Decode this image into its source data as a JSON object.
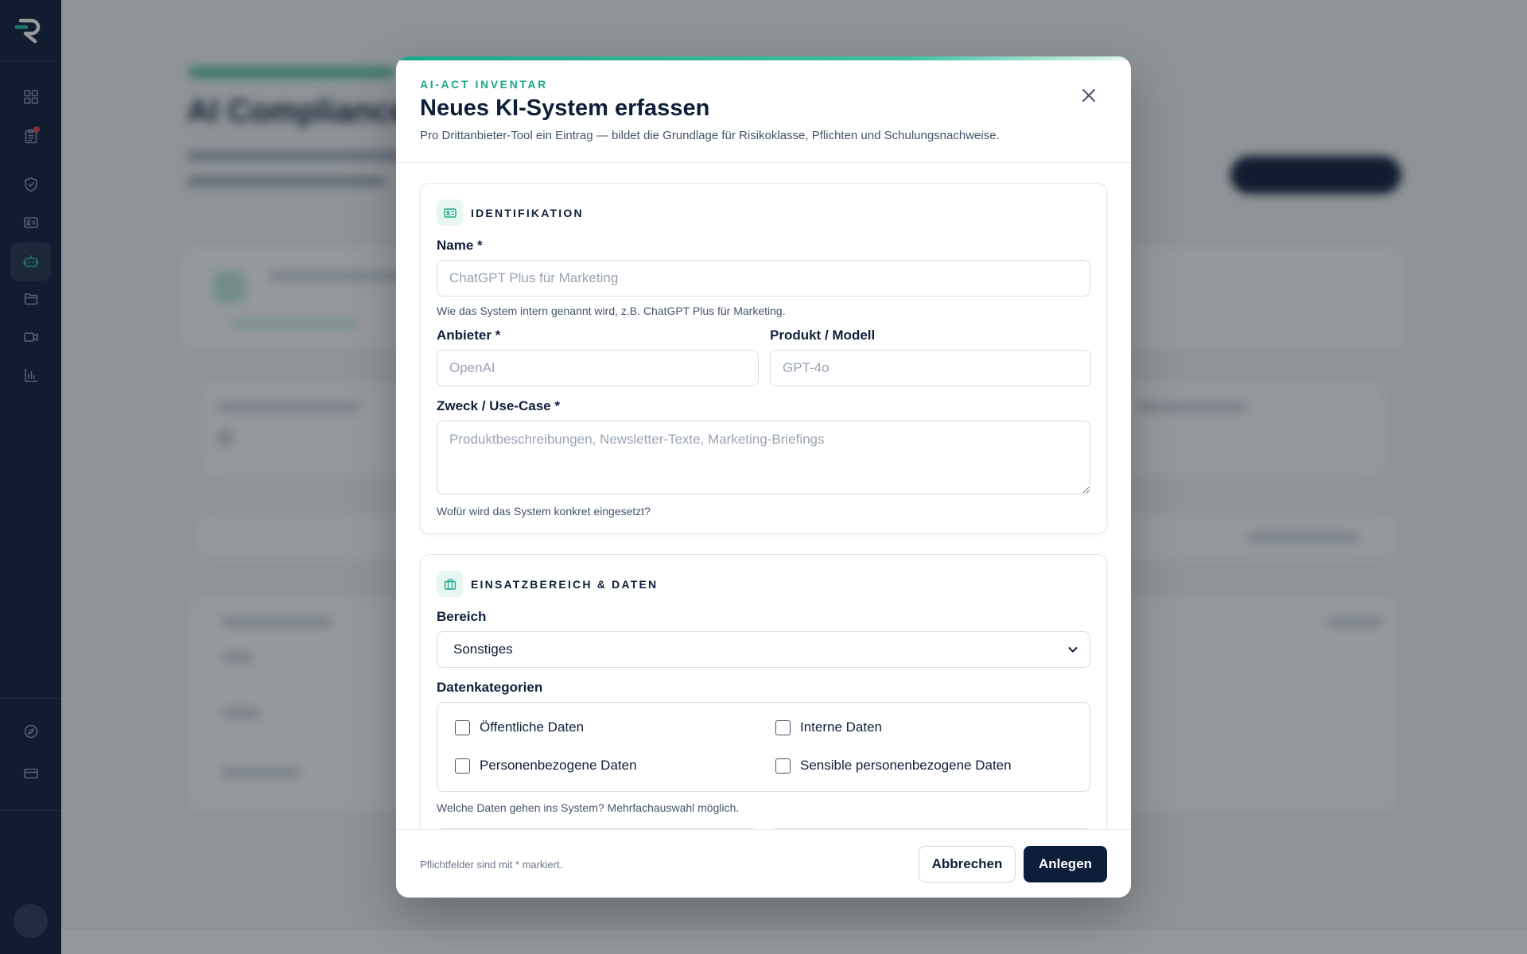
{
  "background": {
    "page_title": "AI Compliance"
  },
  "modal": {
    "eyebrow": "AI-ACT INVENTAR",
    "title": "Neues KI-System erfassen",
    "description": "Pro Drittanbieter-Tool ein Eintrag — bildet die Grundlage für Risikoklasse, Pflichten und Schulungsnachweise.",
    "close_icon": "close-icon",
    "sections": {
      "identifikation": {
        "title": "IDENTIFIKATION",
        "icon": "id-card-icon",
        "name": {
          "label": "Name *",
          "value": "",
          "placeholder": "ChatGPT Plus für Marketing",
          "hint": "Wie das System intern genannt wird, z.B. ChatGPT Plus für Marketing."
        },
        "anbieter": {
          "label": "Anbieter *",
          "value": "",
          "placeholder": "OpenAI"
        },
        "produkt": {
          "label": "Produkt / Modell",
          "value": "",
          "placeholder": "GPT-4o"
        },
        "zweck": {
          "label": "Zweck / Use-Case *",
          "value": "",
          "placeholder": "Produktbeschreibungen, Newsletter-Texte, Marketing-Briefings",
          "hint": "Wofür wird das System konkret eingesetzt?"
        }
      },
      "einsatz": {
        "title": "EINSATZBEREICH & DATEN",
        "icon": "briefcase-icon",
        "bereich": {
          "label": "Bereich",
          "selected": "Sonstiges"
        },
        "datenkategorien": {
          "label": "Datenkategorien",
          "options": [
            {
              "label": "Öffentliche Daten",
              "checked": false
            },
            {
              "label": "Interne Daten",
              "checked": false
            },
            {
              "label": "Personenbezogene Daten",
              "checked": false
            },
            {
              "label": "Sensible personenbezogene Daten",
              "checked": false
            }
          ],
          "hint": "Welche Daten gehen ins System? Mehrfachauswahl möglich."
        }
      }
    },
    "footer": {
      "note": "Pflichtfelder sind mit * markiert.",
      "cancel_label": "Abbrechen",
      "submit_label": "Anlegen"
    }
  },
  "sidebar": {
    "logo": "r-logo",
    "items": [
      {
        "icon": "dashboard-icon",
        "active": false
      },
      {
        "icon": "clipboard-icon",
        "active": false,
        "notification": true
      },
      {
        "icon": "shield-check-icon",
        "active": false
      },
      {
        "icon": "id-card-icon",
        "active": false
      },
      {
        "icon": "robot-icon",
        "active": true
      },
      {
        "icon": "folder-icon",
        "active": false
      },
      {
        "icon": "video-icon",
        "active": false
      },
      {
        "icon": "bar-chart-icon",
        "active": false
      },
      {
        "icon": "compass-icon",
        "active": false
      },
      {
        "icon": "credit-card-icon",
        "active": false
      }
    ]
  },
  "colors": {
    "sidebar": "#0d1e3b",
    "accent": "#1aa88a",
    "primary_button": "#0d1e3b",
    "notification": "#ef3b4c"
  }
}
